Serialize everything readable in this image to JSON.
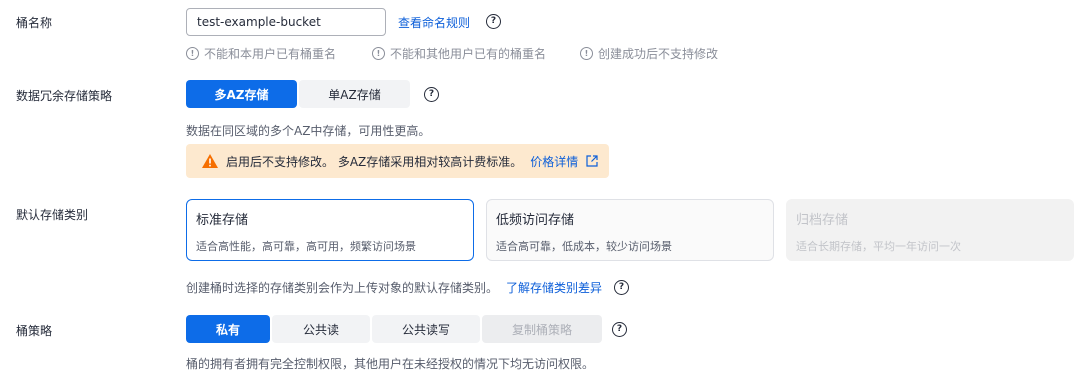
{
  "bucket_name": {
    "label": "桶名称",
    "value": "test-example-bucket",
    "rules_link": "查看命名规则",
    "hints": [
      "不能和本用户已有桶重名",
      "不能和其他用户已有的桶重名",
      "创建成功后不支持修改"
    ]
  },
  "redundancy": {
    "label": "数据冗余存储策略",
    "options": [
      "多AZ存储",
      "单AZ存储"
    ],
    "selected": "多AZ存储",
    "description": "数据在同区域的多个AZ中存储，可用性更高。",
    "warning": "启用后不支持修改。 多AZ存储采用相对较高计费标准。",
    "warning_link": "价格详情"
  },
  "storage_class": {
    "label": "默认存储类别",
    "cards": [
      {
        "title": "标准存储",
        "desc": "适合高性能，高可靠，高可用，频繁访问场景"
      },
      {
        "title": "低频访问存储",
        "desc": "适合高可靠，低成本，较少访问场景"
      },
      {
        "title": "归档存储",
        "desc": "适合长期存储，平均一年访问一次"
      }
    ],
    "selected": "标准存储",
    "description": "创建桶时选择的存储类别会作为上传对象的默认存储类别。",
    "link": "了解存储类别差异"
  },
  "bucket_policy": {
    "label": "桶策略",
    "options": [
      "私有",
      "公共读",
      "公共读写",
      "复制桶策略"
    ],
    "selected": "私有",
    "description": "桶的拥有者拥有完全控制权限，其他用户在未经授权的情况下均无访问权限。"
  },
  "colors": {
    "accent": "#0d6ce8",
    "link": "#0d5fd9",
    "warning_bg": "#fde9cf",
    "warning_icon": "#f66f00"
  }
}
